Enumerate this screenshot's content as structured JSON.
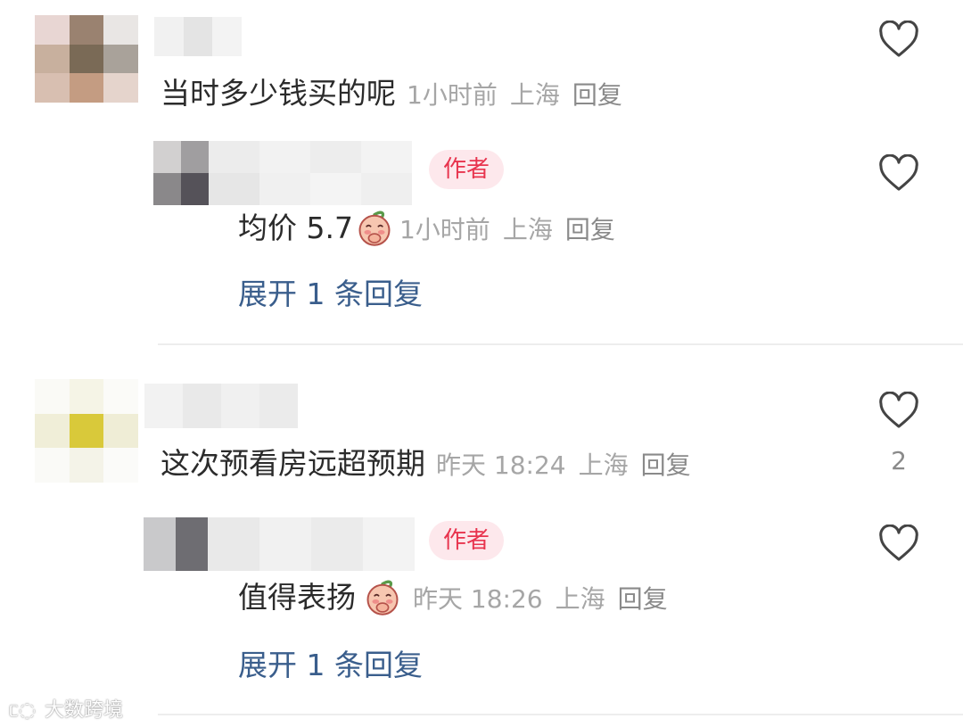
{
  "comments": [
    {
      "text": "当时多少钱买的呢",
      "time": "1小时前",
      "location": "上海",
      "reply_label": "回复",
      "reply": {
        "badge": "作者",
        "text": "均价 5.7",
        "emoji": "peach-covering-mouth-emoji",
        "time": "1小时前",
        "location": "上海",
        "reply_label": "回复"
      },
      "expand_label": "展开 1 条回复"
    },
    {
      "text": "这次预看房远超预期",
      "time": "昨天 18:24",
      "location": "上海",
      "reply_label": "回复",
      "like_count": "2",
      "reply": {
        "badge": "作者",
        "text": "值得表扬",
        "emoji": "peach-covering-mouth-emoji",
        "time": "昨天 18:26",
        "location": "上海",
        "reply_label": "回复"
      },
      "expand_label": "展开 1 条回复"
    }
  ],
  "watermark": "大数跨境",
  "colors": {
    "author_badge_bg": "#fde8ec",
    "author_badge_text": "#e8344e",
    "expand_link": "#3a5e8c",
    "meta_text": "#a6a6a6"
  }
}
